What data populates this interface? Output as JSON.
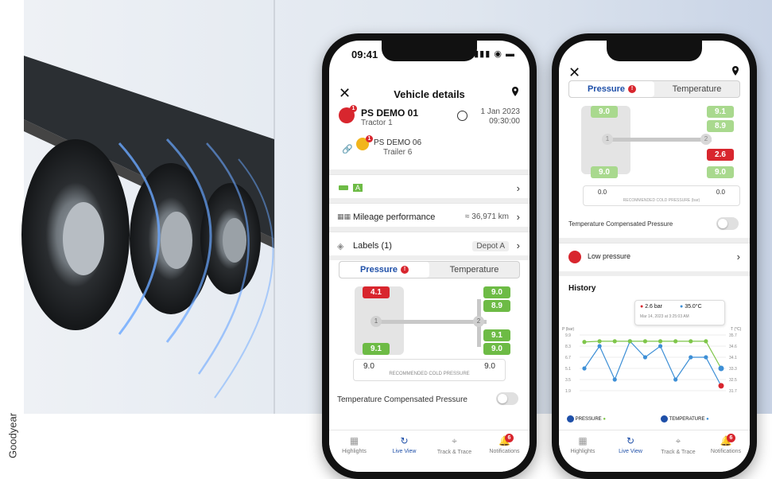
{
  "credit": "Goodyear",
  "phone1": {
    "status": {
      "time": "09:41",
      "icons": "▮▮▮ ◉ ▬"
    },
    "header": {
      "title": "Vehicle details"
    },
    "vehicle": {
      "name": "PS DEMO 01",
      "sub": "Tractor 1",
      "date": "1 Jan 2023",
      "time": "09:30:00",
      "trailer_name": "PS DEMO 06",
      "trailer_sub": "Trailer 6",
      "tractor_badge": "1",
      "trailer_badge": "1"
    },
    "rows": [
      {
        "label": "A",
        "value": ""
      },
      {
        "label": "Mileage performance",
        "value": "≈ 36,971 km"
      },
      {
        "label": "Labels (1)",
        "value": "Depot A"
      }
    ],
    "segment": {
      "active": "Pressure",
      "inactive": "Temperature",
      "badge": "!"
    },
    "tyres": {
      "left_top": "4.1",
      "left_bottom": "9.1",
      "right": [
        "9.0",
        "8.9",
        "9.1",
        "9.0"
      ],
      "axle1": "1",
      "axle2": "2"
    },
    "cold_pressure": {
      "left": "9.0",
      "right": "9.0",
      "label": "RECOMMENDED COLD PRESSURE"
    },
    "temp_comp_label": "Temperature Compensated Pressure",
    "tabs": [
      "Highlights",
      "Live View",
      "Track & Trace",
      "Notifications"
    ],
    "notif_badge": "6"
  },
  "phone2": {
    "segment": {
      "active": "Pressure",
      "inactive": "Temperature",
      "badge": "!"
    },
    "tyres": {
      "left_top": "9.0",
      "left_bottom": "9.0",
      "right": [
        "9.1",
        "8.9",
        "2.6",
        "9.0"
      ],
      "axle1": "1",
      "axle2": "2"
    },
    "cold_pressure": {
      "left": "0.0",
      "right": "0.0",
      "label": "RECOMMENDED COLD PRESSURE (bar)"
    },
    "temp_comp_label": "Temperature Compensated Pressure",
    "alert": "Low pressure",
    "history_title": "History",
    "tooltip": {
      "pressure": "2.6 bar",
      "temperature": "35.0°C",
      "date": "Mar 14, 2023 at 3:25:03 AM"
    },
    "axis": {
      "p_unit": "P\n(bar)",
      "t_unit": "T\n(°C)",
      "p_ticks": [
        "9.9",
        "8.3",
        "6.7",
        "5.1",
        "3.5",
        "1.9"
      ],
      "t_ticks": [
        "35.7",
        "34.6",
        "34.1",
        "33.3",
        "32.5",
        "31.7"
      ]
    },
    "legend": {
      "pressure": "PRESSURE",
      "temperature": "TEMPERATURE"
    },
    "tabs": [
      "Highlights",
      "Live View",
      "Track & Trace",
      "Notifications"
    ],
    "notif_badge": "6"
  },
  "chart_data": {
    "type": "line",
    "title": "History",
    "series": [
      {
        "name": "PRESSURE",
        "color": "#3d8fd6",
        "values": [
          5.1,
          8.3,
          3.5,
          9.0,
          6.7,
          8.3,
          3.5,
          6.7,
          6.7,
          2.6
        ]
      },
      {
        "name": "TEMPERATURE",
        "color": "#7fc64a",
        "values": [
          8.9,
          9.0,
          9.0,
          9.0,
          9.0,
          9.0,
          9.0,
          9.0,
          9.0,
          5.1
        ]
      }
    ],
    "ylim": [
      1.9,
      9.9
    ],
    "ylabel": "P (bar)",
    "y2label": "T (°C)",
    "grid": true
  },
  "colors": {
    "accent": "#1e4fa8",
    "ok": "#6dbb45",
    "alert": "#d8262e"
  }
}
